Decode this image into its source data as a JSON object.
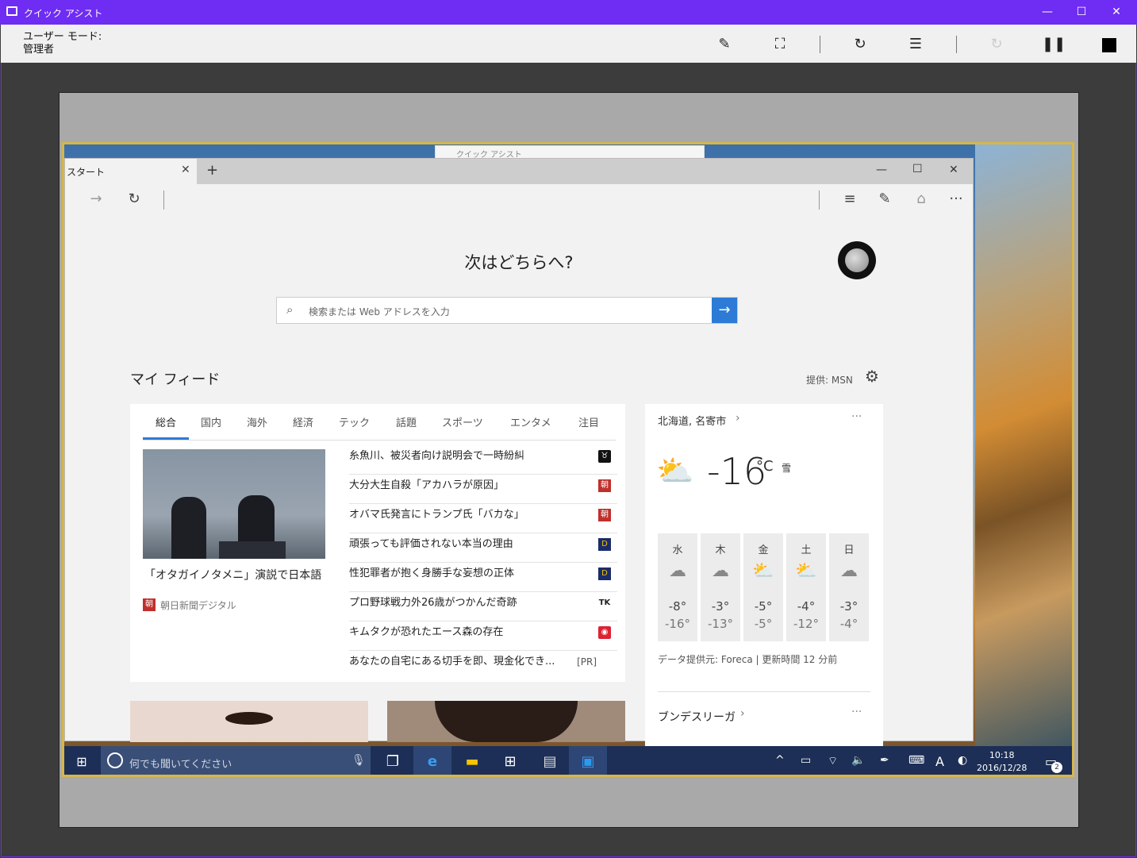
{
  "window": {
    "title": "クイック アシスト",
    "min": "—",
    "max": "☐",
    "close": "✕"
  },
  "toolbar": {
    "mode_label": "ユーザー モード:",
    "mode_value": "管理者"
  },
  "ghost_window": {
    "title": "クイック アシスト"
  },
  "edge": {
    "tab_title": "スタート",
    "heading": "次はどちらへ?",
    "search_placeholder": "検索または Web アドレスを入力",
    "feed_title": "マイ フィード",
    "provider": "提供: MSN"
  },
  "news": {
    "tabs": [
      "総合",
      "国内",
      "海外",
      "経済",
      "テック",
      "話題",
      "スポーツ",
      "エンタメ",
      "注目"
    ],
    "featured_caption": "「オタガイノタメニ」演説で日本語",
    "featured_source": "朝日新聞デジタル",
    "stories": [
      {
        "title": "糸魚川、被災者向け説明会で一時紛糾",
        "badge": "",
        "color": "#111"
      },
      {
        "title": "大分大生自殺「アカハラが原因」",
        "badge": "朝",
        "color": "#c0302c"
      },
      {
        "title": "オバマ氏発言にトランプ氏「バカな」",
        "badge": "朝",
        "color": "#c0302c"
      },
      {
        "title": "頑張っても評価されない本当の理由",
        "badge": "D",
        "color": "#1b2c6b"
      },
      {
        "title": "性犯罪者が抱く身勝手な妄想の正体",
        "badge": "D",
        "color": "#1b2c6b"
      },
      {
        "title": "プロ野球戦力外26歳がつかんだ奇跡",
        "badge": "TK",
        "color": "#222"
      },
      {
        "title": "キムタクが恐れたエース森の存在",
        "badge": "",
        "color": "#d23"
      },
      {
        "title": "あなたの自宅にある切手を即、現金化でき...",
        "badge": "[PR]",
        "color": ""
      }
    ]
  },
  "weather": {
    "location": "北海道, 名寄市",
    "temp": "-16",
    "unit": "°C",
    "condition": "雪",
    "forecast": [
      {
        "day": "水",
        "high": "-8°",
        "low": "-16°"
      },
      {
        "day": "木",
        "high": "-3°",
        "low": "-13°"
      },
      {
        "day": "金",
        "high": "-5°",
        "low": "-5°"
      },
      {
        "day": "土",
        "high": "-4°",
        "low": "-12°"
      },
      {
        "day": "日",
        "high": "-3°",
        "low": "-4°"
      }
    ],
    "source": "データ提供元: Foreca | 更新時間 12 分前",
    "next_section": "ブンデスリーガ",
    "more": "···"
  },
  "taskbar": {
    "cortana_placeholder": "何でも聞いてください",
    "time": "10:18",
    "date": "2016/12/28",
    "notifications": "2",
    "ime": "A"
  }
}
